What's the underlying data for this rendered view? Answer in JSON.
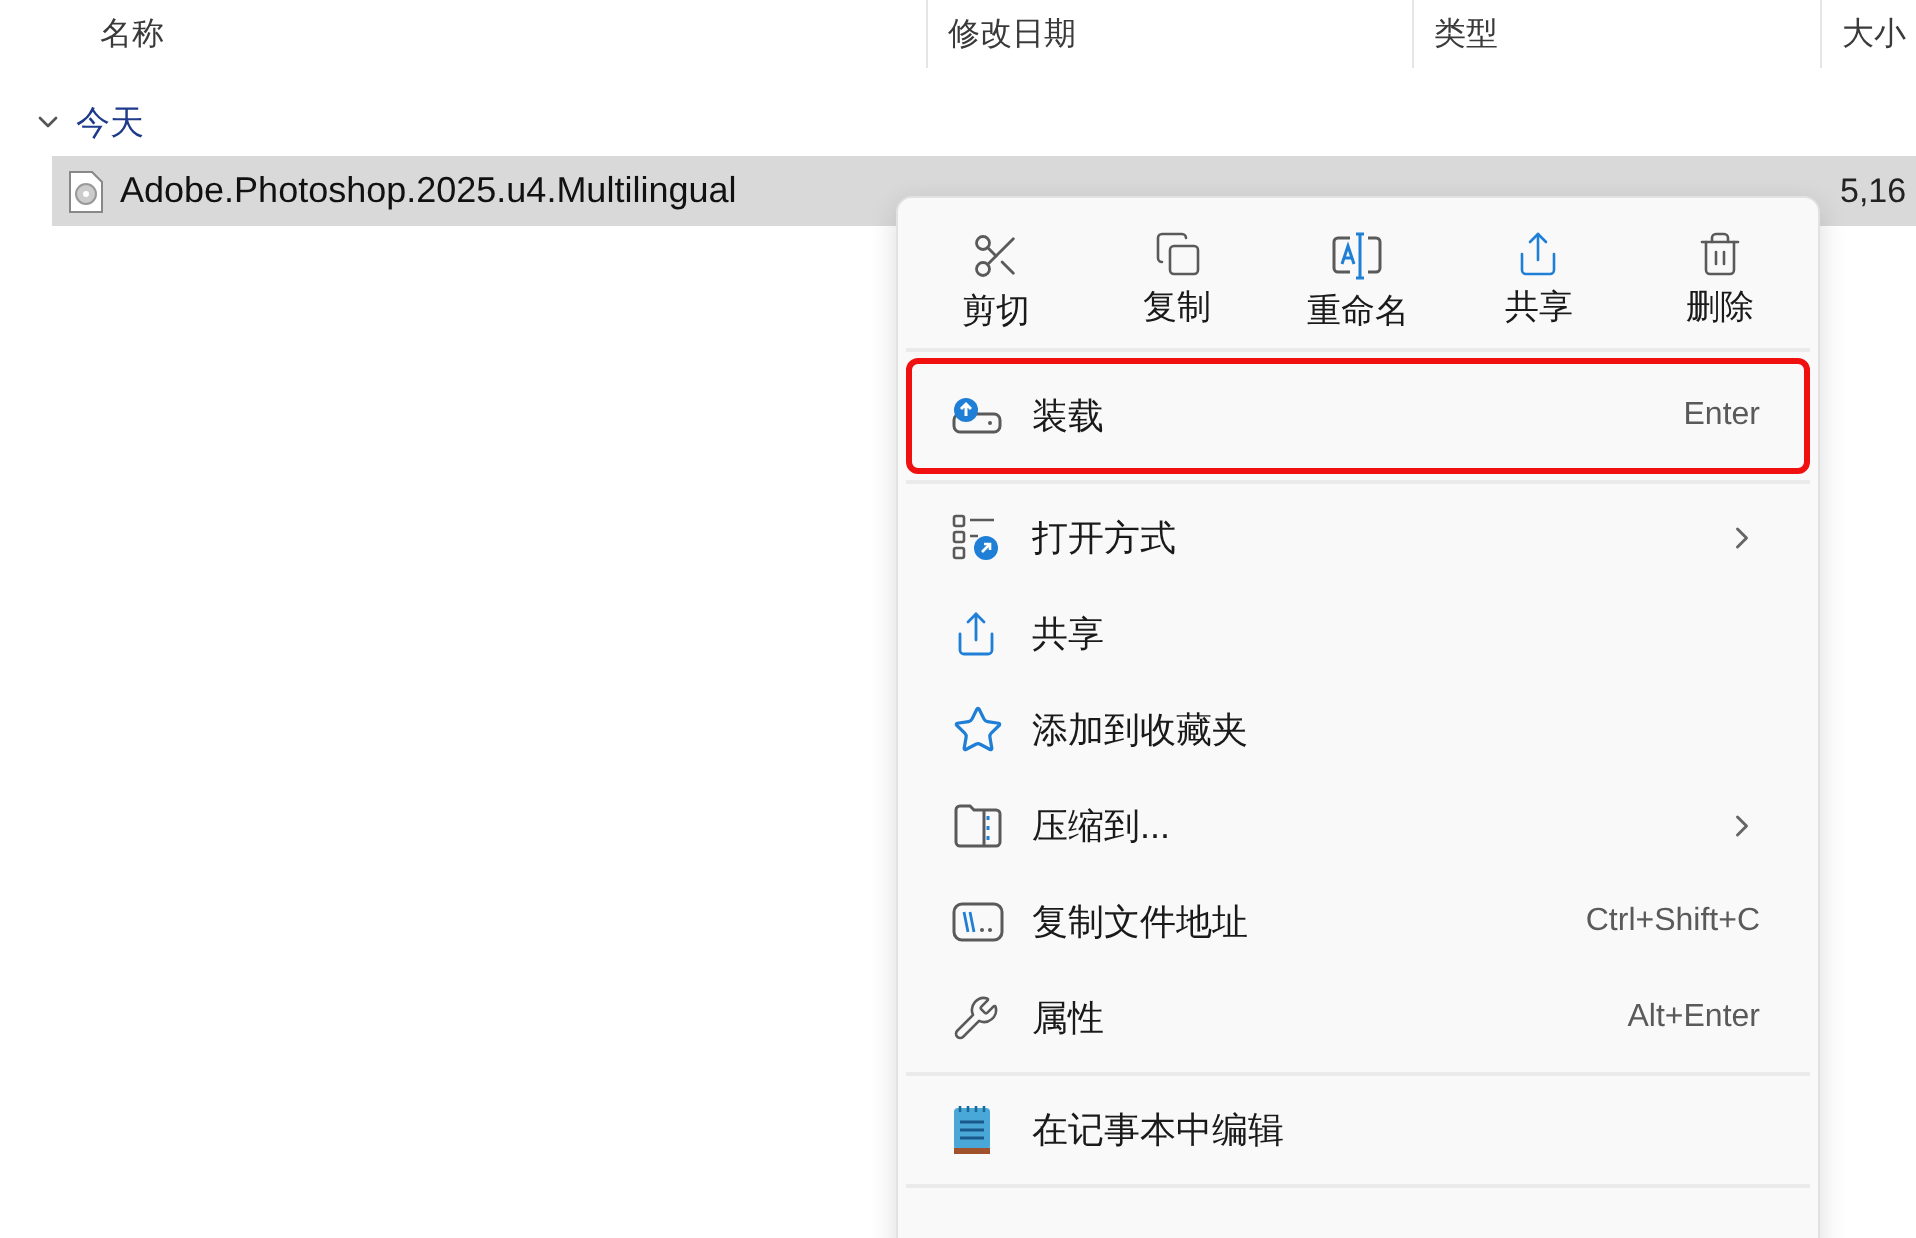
{
  "columns": [
    "名称",
    "修改日期",
    "类型",
    "大小"
  ],
  "group": {
    "label": "今天",
    "expanded": true
  },
  "rows": [
    {
      "name": "Adobe.Photoshop.2025.u4.Multilingual",
      "size": "5,16",
      "selected": true
    }
  ],
  "context_menu": {
    "actions": [
      "剪切",
      "复制",
      "重命名",
      "共享",
      "删除"
    ],
    "sections": [
      [
        {
          "label": "装载",
          "shortcut": "Enter",
          "highlighted": true
        }
      ],
      [
        {
          "label": "打开方式",
          "submenu": true
        },
        {
          "label": "共享"
        },
        {
          "label": "添加到收藏夹"
        },
        {
          "label": "压缩到...",
          "submenu": true
        },
        {
          "label": "复制文件地址",
          "shortcut": "Ctrl+Shift+C"
        },
        {
          "label": "属性",
          "shortcut": "Alt+Enter"
        }
      ],
      [
        {
          "label": "在记事本中编辑"
        }
      ]
    ]
  }
}
